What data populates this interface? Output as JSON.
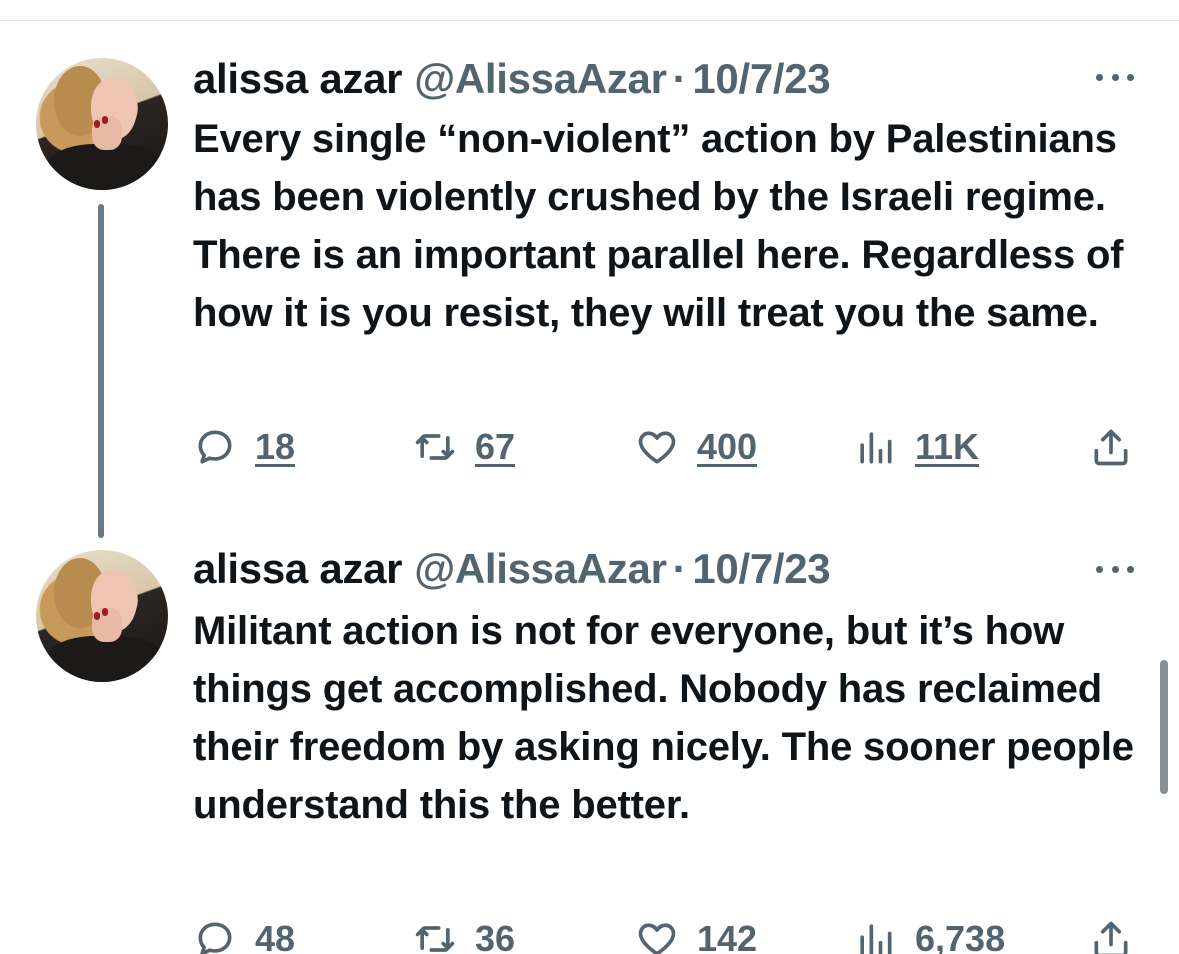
{
  "tweets": [
    {
      "display_name": "alissa azar",
      "handle": "@AlissaAzar",
      "separator": "·",
      "date": "10/7/23",
      "text": "Every single “non-violent” action by Palestinians has been violently crushed by the Israeli regime. There is an important parallel here. Regardless of how it is you resist, they will treat you the same.",
      "replies": "18",
      "reposts": "67",
      "likes": "400",
      "views": "11K"
    },
    {
      "display_name": "alissa azar",
      "handle": "@AlissaAzar",
      "separator": "·",
      "date": "10/7/23",
      "text": "Militant action is not for everyone, but it’s how things get accomplished. Nobody has reclaimed their freedom by asking nicely. The sooner people understand this the better.",
      "replies": "48",
      "reposts": "36",
      "likes": "142",
      "views": "6,738"
    }
  ],
  "icons": {
    "reply": "reply-icon",
    "repost": "repost-icon",
    "like": "heart-icon",
    "views": "views-icon",
    "share": "share-icon",
    "more": "more-icon"
  },
  "colors": {
    "text_primary": "#0f1419",
    "text_secondary": "#536471",
    "thread_line": "#6b7885",
    "divider": "#e1e6ea"
  }
}
